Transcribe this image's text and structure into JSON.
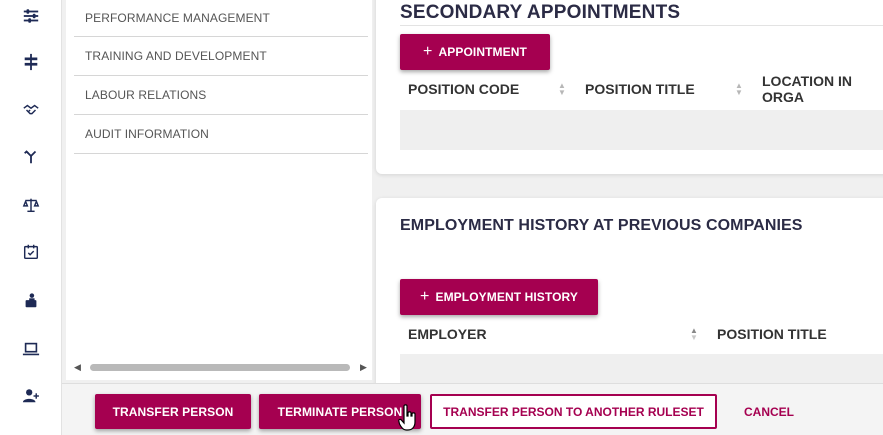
{
  "rail": {
    "icons": [
      "sliders-icon",
      "signpost-icon",
      "handshake-icon",
      "split-arrow-icon",
      "scales-icon",
      "calendar-check-icon",
      "person-laptop-icon",
      "laptop-icon",
      "add-person-icon"
    ]
  },
  "menu": {
    "items": [
      {
        "label": "PERFORMANCE MANAGEMENT"
      },
      {
        "label": "TRAINING AND DEVELOPMENT"
      },
      {
        "label": "LABOUR RELATIONS"
      },
      {
        "label": "AUDIT INFORMATION"
      }
    ]
  },
  "secondary": {
    "title": "SECONDARY APPOINTMENTS",
    "add_button": "APPOINTMENT",
    "columns": [
      "POSITION CODE",
      "POSITION TITLE",
      "LOCATION IN ORGA"
    ]
  },
  "history": {
    "title": "EMPLOYMENT HISTORY AT PREVIOUS COMPANIES",
    "add_button": "EMPLOYMENT HISTORY",
    "columns": [
      "EMPLOYER",
      "POSITION TITLE"
    ]
  },
  "footer": {
    "transfer": "TRANSFER PERSON",
    "terminate": "TERMINATE PERSON",
    "transfer_ruleset": "TRANSFER PERSON TO ANOTHER RULESET",
    "cancel": "CANCEL"
  },
  "colors": {
    "accent": "#a50050",
    "nav_icon": "#1e2a55"
  }
}
